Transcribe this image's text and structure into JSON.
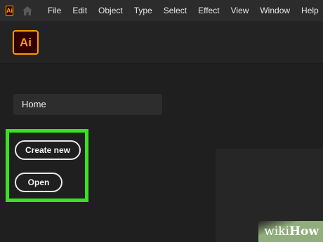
{
  "app": {
    "small_icon_text": "Ai",
    "logo_text": "Ai",
    "brand_color": "#ff9a00",
    "brand_bg": "#330000"
  },
  "menubar": {
    "items": [
      "File",
      "Edit",
      "Object",
      "Type",
      "Select",
      "Effect",
      "View",
      "Window",
      "Help"
    ]
  },
  "sidebar": {
    "home_label": "Home",
    "create_new_label": "Create new",
    "open_label": "Open"
  },
  "annotation": {
    "highlight_color": "#39e221"
  },
  "watermark": {
    "wiki": "wiki",
    "how": "How"
  }
}
